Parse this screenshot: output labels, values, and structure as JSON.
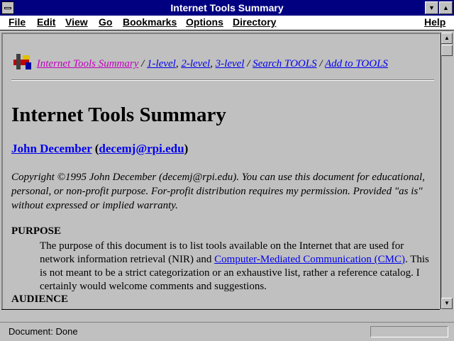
{
  "window": {
    "title": "Internet Tools Summary"
  },
  "menu": {
    "file": "File",
    "edit": "Edit",
    "view": "View",
    "go": "Go",
    "bookmarks": "Bookmarks",
    "options": "Options",
    "directory": "Directory",
    "help": "Help"
  },
  "nav": {
    "link_summary": "Internet Tools Summary",
    "sep1": " / ",
    "link_1level": "1-level",
    "comma1": ", ",
    "link_2level": "2-level",
    "comma2": ", ",
    "link_3level": "3-level",
    "sep2": " / ",
    "link_search": "Search TOOLS",
    "sep3": " / ",
    "link_add": "Add to TOOLS"
  },
  "page": {
    "heading": "Internet Tools Summary",
    "author_name": "John December",
    "author_open": " (",
    "author_email": "decemj@rpi.edu",
    "author_close": ")",
    "copyright": "Copyright ©1995 John December (decemj@rpi.edu). You can use this document for educational, personal, or non-profit purpose. For-profit distribution requires my permission. Provided \"as is\" without expressed or implied warranty.",
    "purpose_heading": "PURPOSE",
    "purpose_text_before": "The purpose of this document is to list tools available on the Internet that are used for network information retrieval (NIR) and ",
    "purpose_link": "Computer-Mediated Communication (CMC)",
    "purpose_text_after": ". This is not meant to be a strict categorization or an exhaustive list, rather a reference catalog. I certainly would welcome comments and suggestions.",
    "audience_heading": "AUDIENCE"
  },
  "status": {
    "text": "Document: Done"
  }
}
